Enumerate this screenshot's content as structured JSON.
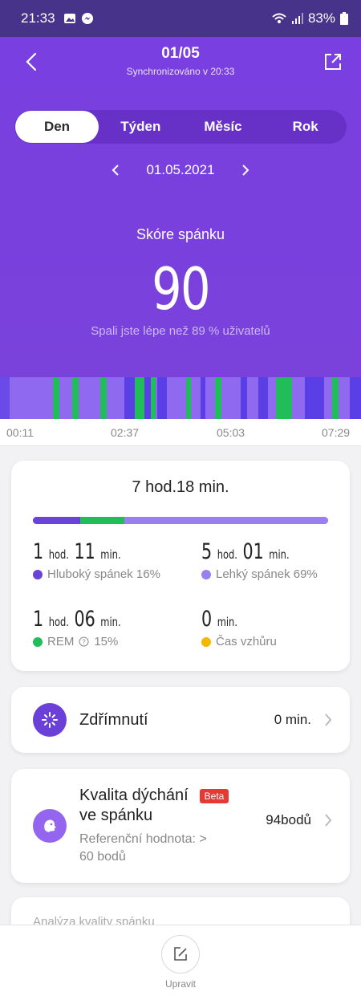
{
  "status_bar": {
    "time": "21:33",
    "battery": "83%"
  },
  "header": {
    "title": "01/05",
    "subtitle": "Synchronizováno v 20:33"
  },
  "period_tabs": [
    {
      "label": "Den",
      "active": true
    },
    {
      "label": "Týden",
      "active": false
    },
    {
      "label": "Měsíc",
      "active": false
    },
    {
      "label": "Rok",
      "active": false
    }
  ],
  "date_nav": {
    "date": "01.05.2021"
  },
  "score": {
    "label": "Skóre spánku",
    "value": "90",
    "note": "Spali jste lépe než 89 % uživatelů"
  },
  "timeline": {
    "ticks": [
      "00:11",
      "02:37",
      "05:03",
      "07:29"
    ]
  },
  "summary": {
    "total": "7 hod.18 min.",
    "deep": {
      "hours": "1",
      "h_unit": "hod.",
      "minutes": "11",
      "m_unit": "min.",
      "label": "Hluboký spánek 16%",
      "color": "#6a43d8",
      "share": 16
    },
    "light": {
      "hours": "5",
      "h_unit": "hod.",
      "minutes": "01",
      "m_unit": "min.",
      "label": "Lehký spánek 69%",
      "color": "#9a7ff0",
      "share": 69
    },
    "rem": {
      "hours": "1",
      "h_unit": "hod.",
      "minutes": "06",
      "m_unit": "min.",
      "label": "REM",
      "pct": "15%",
      "color": "#20bd5a",
      "share": 15
    },
    "awake": {
      "minutes": "0",
      "m_unit": "min.",
      "label": "Čas vzhůru",
      "color": "#f5b800"
    }
  },
  "nap": {
    "title": "Zdřímnutí",
    "value": "0 min."
  },
  "breathing": {
    "title_line1": "Kvalita dýchání",
    "title_line2": "ve spánku",
    "badge": "Beta",
    "ref_line1": "Referenční hodnota: >",
    "ref_line2": "60 bodů",
    "value": "94bodů"
  },
  "analysis": {
    "title": "Analýza kvality spánku"
  },
  "bottom": {
    "edit_label": "Upravit"
  }
}
